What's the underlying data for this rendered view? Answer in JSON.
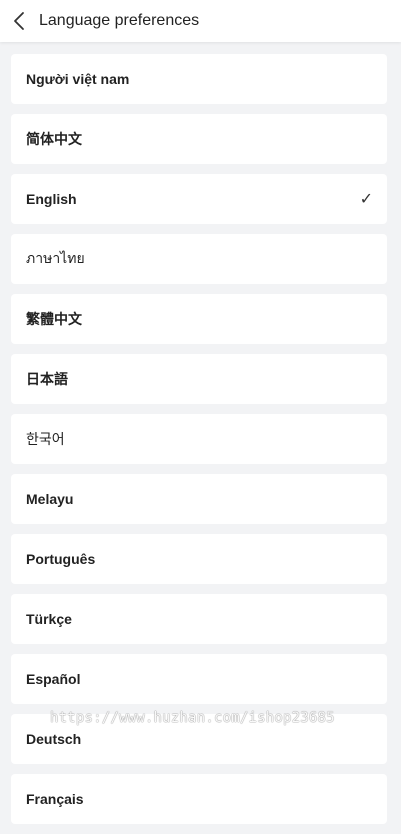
{
  "header": {
    "back_icon": "chevron-left-icon",
    "title": "Language preferences"
  },
  "languages": [
    {
      "label": "Người việt nam",
      "selected": false
    },
    {
      "label": "简体中文",
      "selected": false
    },
    {
      "label": "English",
      "selected": true
    },
    {
      "label": "ภาษาไทย",
      "selected": false
    },
    {
      "label": "繁體中文",
      "selected": false
    },
    {
      "label": "日本語",
      "selected": false
    },
    {
      "label": "한국어",
      "selected": false
    },
    {
      "label": "Melayu",
      "selected": false
    },
    {
      "label": "Português",
      "selected": false
    },
    {
      "label": "Türkçe",
      "selected": false
    },
    {
      "label": "Español",
      "selected": false
    },
    {
      "label": "Deutsch",
      "selected": false
    },
    {
      "label": "Français",
      "selected": false
    }
  ],
  "check_mark": "✓",
  "watermark": "https://www.huzhan.com/ishop23685"
}
